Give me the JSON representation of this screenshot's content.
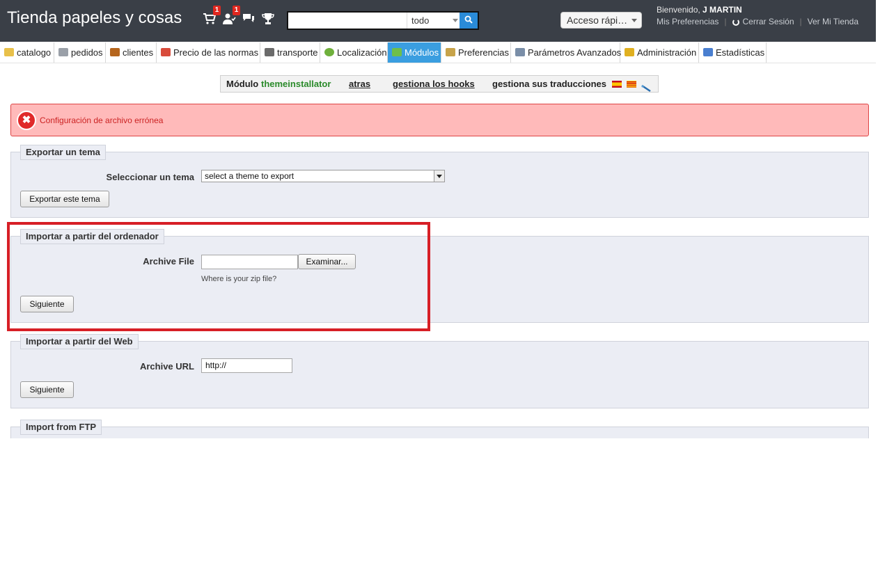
{
  "header": {
    "shop_title": "Tienda papeles y cosas",
    "orders_badge": "1",
    "customers_badge": "1",
    "search": {
      "value": "",
      "placeholder": "",
      "scope": "todo"
    },
    "quick_access": "Acceso rápi…",
    "welcome_prefix": "Bienvenido, ",
    "user_name": "J MARTIN",
    "links": {
      "preferences": "Mis Preferencias",
      "logout": "Cerrar Sesión",
      "view_shop": "Ver Mi Tienda"
    }
  },
  "tabs": [
    {
      "label": "catalogo",
      "icon": "folder-icon",
      "color": "#e8c04a"
    },
    {
      "label": "pedidos",
      "icon": "cart-icon",
      "color": "#9aa0a8"
    },
    {
      "label": "clientes",
      "icon": "user-icon",
      "color": "#b5651d"
    },
    {
      "label": "Precio de las normas",
      "icon": "price-rules-icon",
      "color": "#d84b3b"
    },
    {
      "label": "transporte",
      "icon": "truck-icon",
      "color": "#6b6b6b"
    },
    {
      "label": "Localización",
      "icon": "globe-icon",
      "color": "#6fb03c"
    },
    {
      "label": "Módulos",
      "icon": "puzzle-icon",
      "color": "#6fbf4a"
    },
    {
      "label": "Preferencias",
      "icon": "preferences-icon",
      "color": "#c7a34a"
    },
    {
      "label": "Parámetros Avanzados",
      "icon": "wrench-icon",
      "color": "#7a8ea8"
    },
    {
      "label": "Administración",
      "icon": "key-icon",
      "color": "#e0b020"
    },
    {
      "label": "Estadísticas",
      "icon": "stats-icon",
      "color": "#4a7fd0"
    }
  ],
  "active_tab": "Módulos",
  "module_bar": {
    "prefix": "Módulo",
    "module_name": "themeinstallator",
    "back": "atras",
    "hooks": "gestiona los hooks",
    "translations": "gestiona sus traducciones"
  },
  "error": {
    "message": "Configuración de archivo errónea"
  },
  "export_section": {
    "legend": "Exportar un tema",
    "label": "Seleccionar un tema",
    "select_value": "select a theme to export",
    "button": "Exportar este tema"
  },
  "import_computer": {
    "legend": "Importar a partir del ordenador",
    "label": "Archive File",
    "browse_button": "Examinar...",
    "hint": "Where is your zip file?",
    "button": "Siguiente"
  },
  "import_web": {
    "legend": "Importar a partir del Web",
    "label": "Archive URL",
    "url_value": "http://",
    "button": "Siguiente"
  },
  "import_ftp": {
    "legend": "Import from FTP"
  },
  "colors": {
    "header_bg": "#3a3f47",
    "active_tab": "#3a9ee0",
    "error_bg": "#ffbaba",
    "highlight_box": "#d71f26",
    "fieldset_bg": "#ebedf4"
  }
}
